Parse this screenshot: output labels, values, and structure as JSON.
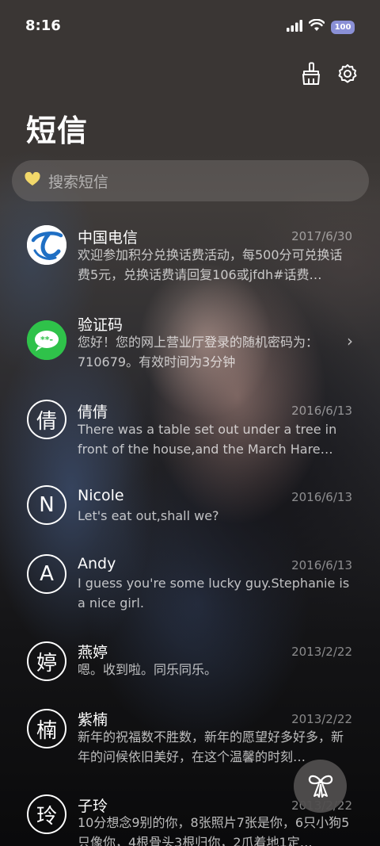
{
  "status_bar": {
    "time": "8:16",
    "battery": "100"
  },
  "header": {
    "title": "短信",
    "clean_icon": "broom-icon",
    "settings_icon": "gear-icon"
  },
  "search": {
    "placeholder": "搜索短信",
    "icon": "heart-icon",
    "icon_color": "#f2d86a"
  },
  "messages": [
    {
      "name": "中国电信",
      "date": "2017/6/30",
      "preview": "欢迎参加积分兑换话费活动，每500分可兑换话费5元，兑换话费请回复106或jfdh#话费…",
      "avatar": "china-telecom-logo"
    },
    {
      "name": "验证码",
      "date": "",
      "preview": "您好！您的网上营业厅登录的随机密码为：710679。有效时间为3分钟",
      "avatar": "message-bubble-icon"
    },
    {
      "name": "倩倩",
      "date": "2016/6/13",
      "preview": "There was a table set out under a tree in front of the house,and the March Hare an…",
      "avatar_letter": "倩"
    },
    {
      "name": "Nicole",
      "date": "2016/6/13",
      "preview": "Let's eat out,shall we?",
      "avatar_letter": "N"
    },
    {
      "name": "Andy",
      "date": "2016/6/13",
      "preview": "I guess you're some lucky guy.Stephanie is a nice girl.",
      "avatar_letter": "A"
    },
    {
      "name": "燕婷",
      "date": "2013/2/22",
      "preview": "嗯。收到啦。同乐同乐。",
      "avatar_letter": "婷"
    },
    {
      "name": "紫楠",
      "date": "2013/2/22",
      "preview": "新年的祝福数不胜数，新年的愿望好多好多，新年的问候依旧美好，在这个温馨的时刻…",
      "avatar_letter": "楠"
    },
    {
      "name": "子玲",
      "date": "2013/2/22",
      "preview": "10分想念9别的你，8张照片7张是你，6只小狗5只像你，4根骨头3根归你，2爪着地1定…",
      "avatar_letter": "玲"
    }
  ],
  "fab": {
    "icon": "bow-icon"
  },
  "colors": {
    "telecom_blue": "#1f6fc4",
    "verify_green": "#2fc24a"
  }
}
